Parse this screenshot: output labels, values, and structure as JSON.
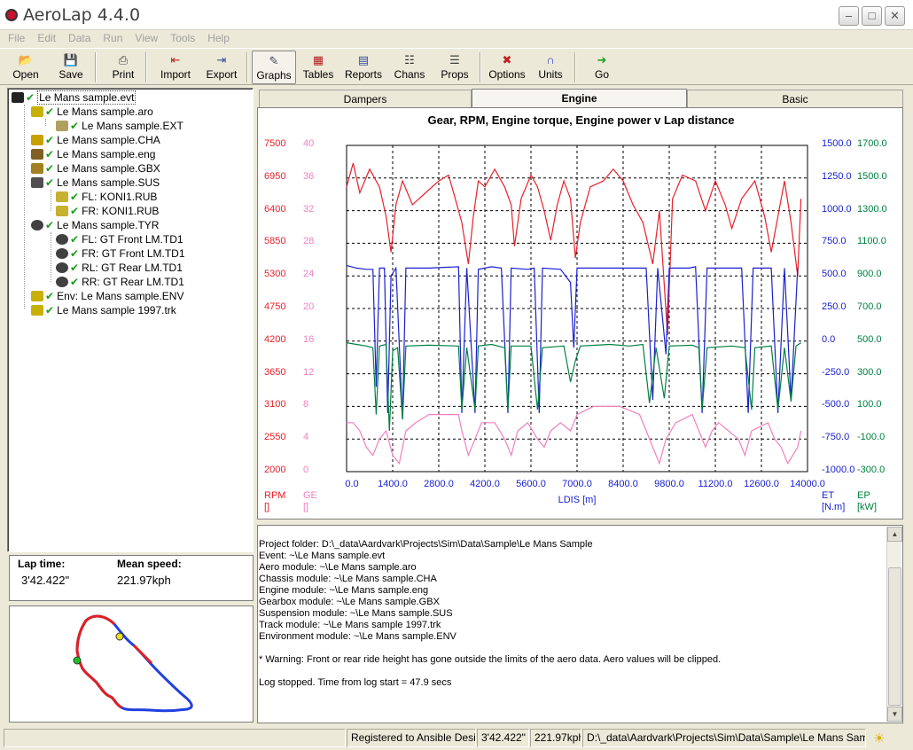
{
  "window": {
    "title": "AeroLap 4.4.0"
  },
  "menu": [
    "File",
    "Edit",
    "Data",
    "Run",
    "View",
    "Tools",
    "Help"
  ],
  "toolbar": [
    {
      "label": "Open",
      "icon": "folder-open-icon"
    },
    {
      "label": "Save",
      "icon": "floppy-disk-icon"
    },
    {
      "label": "Print",
      "icon": "printer-icon"
    },
    {
      "label": "Import",
      "icon": "import-icon"
    },
    {
      "label": "Export",
      "icon": "export-icon"
    },
    {
      "label": "Graphs",
      "icon": "graph-icon",
      "pressed": true
    },
    {
      "label": "Tables",
      "icon": "table-icon"
    },
    {
      "label": "Reports",
      "icon": "report-icon"
    },
    {
      "label": "Chans",
      "icon": "channels-icon"
    },
    {
      "label": "Props",
      "icon": "properties-icon"
    },
    {
      "label": "Options",
      "icon": "tools-icon"
    },
    {
      "label": "Units",
      "icon": "magnet-icon"
    },
    {
      "label": "Go",
      "icon": "go-arrow-icon"
    }
  ],
  "tree": [
    {
      "label": "Le Mans sample.evt",
      "level": 0,
      "icon": "chequered-flag-icon",
      "selected": true
    },
    {
      "label": "Le Mans sample.aro",
      "level": 1,
      "icon": "wing-icon"
    },
    {
      "label": "Le Mans sample.EXT",
      "level": 2,
      "icon": "extension-icon"
    },
    {
      "label": "Le Mans sample.CHA",
      "level": 1,
      "icon": "chassis-icon"
    },
    {
      "label": "Le Mans sample.eng",
      "level": 1,
      "icon": "engine-icon"
    },
    {
      "label": "Le Mans sample.GBX",
      "level": 1,
      "icon": "gearbox-icon"
    },
    {
      "label": "Le Mans sample.SUS",
      "level": 1,
      "icon": "spring-icon"
    },
    {
      "label": "FL: KONI1.RUB",
      "level": 2,
      "icon": "damper-icon"
    },
    {
      "label": "FR: KONI1.RUB",
      "level": 2,
      "icon": "damper-icon"
    },
    {
      "label": "Le Mans sample.TYR",
      "level": 1,
      "icon": "tyre-icon"
    },
    {
      "label": "FL: GT Front LM.TD1",
      "level": 2,
      "icon": "tyre-icon"
    },
    {
      "label": "FR: GT Front LM.TD1",
      "level": 2,
      "icon": "tyre-icon"
    },
    {
      "label": "RL: GT Rear LM.TD1",
      "level": 2,
      "icon": "tyre-icon"
    },
    {
      "label": "RR: GT Rear LM.TD1",
      "level": 2,
      "icon": "tyre-icon"
    },
    {
      "label": "Env: Le Mans sample.ENV",
      "level": 1,
      "icon": "weather-icon"
    },
    {
      "label": "Le Mans sample 1997.trk",
      "level": 1,
      "icon": "track-icon"
    }
  ],
  "lap": {
    "lap_time_label": "Lap time:",
    "lap_time": "3'42.422\"",
    "mean_speed_label": "Mean speed:",
    "mean_speed": "221.97kph"
  },
  "tabs": [
    {
      "label": "Dampers",
      "active": false
    },
    {
      "label": "Engine",
      "active": true
    },
    {
      "label": "Basic",
      "active": false
    }
  ],
  "chart_data": {
    "type": "line",
    "title": "Gear, RPM, Engine torque, Engine power v Lap distance",
    "xlabel": "LDIS [m]",
    "xlim": [
      0,
      14000
    ],
    "x_ticks": [
      "0.0",
      "1400.0",
      "2800.0",
      "4200.0",
      "5600.0",
      "7000.0",
      "8400.0",
      "9800.0",
      "11200.0",
      "12600.0",
      "14000.0"
    ],
    "grid": true,
    "axes": [
      {
        "name": "RPM",
        "unit": "[]",
        "side": "left",
        "color": "#e8202a",
        "ylim": [
          2000,
          7500
        ],
        "ticks": [
          "7500",
          "6950",
          "6400",
          "5850",
          "5300",
          "4750",
          "4200",
          "3650",
          "3100",
          "2550",
          "2000"
        ]
      },
      {
        "name": "GE",
        "unit": "[]",
        "side": "left",
        "color": "#f080c0",
        "ylim": [
          0,
          40
        ],
        "ticks": [
          "40",
          "36",
          "32",
          "28",
          "24",
          "20",
          "16",
          "12",
          "8",
          "4",
          "0"
        ]
      },
      {
        "name": "ET",
        "unit": "[N.m]",
        "side": "right",
        "color": "#1a20d0",
        "ylim": [
          -1000,
          1500
        ],
        "ticks": [
          "1500.0",
          "1250.0",
          "1000.0",
          "750.0",
          "500.0",
          "250.0",
          "0.0",
          "-250.0",
          "-500.0",
          "-750.0",
          "-1000.0"
        ]
      },
      {
        "name": "EP",
        "unit": "[kW]",
        "side": "right",
        "color": "#008040",
        "ylim": [
          -300,
          1700
        ],
        "ticks": [
          "1700.0",
          "1500.0",
          "1300.0",
          "1100.0",
          "900.0",
          "700.0",
          "500.0",
          "300.0",
          "100.0",
          "-100.0",
          "-300.0"
        ]
      }
    ],
    "series": [
      {
        "name": "RPM",
        "axis": "RPM",
        "color": "#e8202a",
        "points": [
          [
            0,
            6800
          ],
          [
            200,
            7200
          ],
          [
            400,
            6700
          ],
          [
            700,
            7100
          ],
          [
            1000,
            6800
          ],
          [
            1200,
            6300
          ],
          [
            1350,
            5700
          ],
          [
            1500,
            6500
          ],
          [
            1700,
            6900
          ],
          [
            2000,
            6500
          ],
          [
            2400,
            6700
          ],
          [
            2800,
            6900
          ],
          [
            3100,
            7000
          ],
          [
            3300,
            6600
          ],
          [
            3500,
            6200
          ],
          [
            3700,
            5500
          ],
          [
            3850,
            6300
          ],
          [
            4000,
            6900
          ],
          [
            4200,
            6800
          ],
          [
            4500,
            7100
          ],
          [
            4800,
            6800
          ],
          [
            5000,
            6500
          ],
          [
            5100,
            5800
          ],
          [
            5300,
            6600
          ],
          [
            5600,
            7000
          ],
          [
            5800,
            6800
          ],
          [
            6000,
            6400
          ],
          [
            6200,
            5900
          ],
          [
            6400,
            6500
          ],
          [
            6600,
            6900
          ],
          [
            6800,
            6600
          ],
          [
            6950,
            5600
          ],
          [
            7100,
            6200
          ],
          [
            7400,
            6800
          ],
          [
            7800,
            6900
          ],
          [
            8100,
            7100
          ],
          [
            8400,
            6900
          ],
          [
            8700,
            6500
          ],
          [
            9000,
            6200
          ],
          [
            9300,
            5500
          ],
          [
            9500,
            6400
          ],
          [
            9750,
            4300
          ],
          [
            9900,
            6600
          ],
          [
            10200,
            7000
          ],
          [
            10600,
            6900
          ],
          [
            10900,
            6400
          ],
          [
            11200,
            6900
          ],
          [
            11500,
            6500
          ],
          [
            11700,
            6100
          ],
          [
            12000,
            6600
          ],
          [
            12400,
            6900
          ],
          [
            12700,
            6300
          ],
          [
            12900,
            5700
          ],
          [
            13100,
            6300
          ],
          [
            13300,
            6900
          ],
          [
            13500,
            6200
          ],
          [
            13700,
            5300
          ],
          [
            13800,
            6600
          ]
        ]
      },
      {
        "name": "ET",
        "axis": "ET",
        "color": "#1a20d0",
        "points": [
          [
            0,
            580
          ],
          [
            300,
            560
          ],
          [
            600,
            550
          ],
          [
            800,
            550
          ],
          [
            900,
            -350
          ],
          [
            1000,
            560
          ],
          [
            1150,
            560
          ],
          [
            1250,
            -550
          ],
          [
            1350,
            500
          ],
          [
            1500,
            560
          ],
          [
            1700,
            -600
          ],
          [
            1800,
            560
          ],
          [
            2500,
            560
          ],
          [
            3400,
            570
          ],
          [
            3500,
            -550
          ],
          [
            3650,
            560
          ],
          [
            3900,
            -550
          ],
          [
            4000,
            550
          ],
          [
            4200,
            560
          ],
          [
            4400,
            570
          ],
          [
            4700,
            560
          ],
          [
            4900,
            -550
          ],
          [
            5000,
            560
          ],
          [
            5500,
            550
          ],
          [
            5700,
            560
          ],
          [
            5850,
            -550
          ],
          [
            5950,
            560
          ],
          [
            6500,
            550
          ],
          [
            6800,
            450
          ],
          [
            6900,
            -50
          ],
          [
            7000,
            560
          ],
          [
            7600,
            560
          ],
          [
            8500,
            560
          ],
          [
            9100,
            560
          ],
          [
            9300,
            -450
          ],
          [
            9450,
            560
          ],
          [
            9700,
            -100
          ],
          [
            9800,
            560
          ],
          [
            10400,
            560
          ],
          [
            10600,
            570
          ],
          [
            10800,
            -550
          ],
          [
            10950,
            560
          ],
          [
            11600,
            560
          ],
          [
            12000,
            560
          ],
          [
            12200,
            -550
          ],
          [
            12350,
            560
          ],
          [
            12900,
            560
          ],
          [
            13100,
            -550
          ],
          [
            13300,
            560
          ],
          [
            13500,
            -450
          ],
          [
            13700,
            560
          ]
        ]
      },
      {
        "name": "EP",
        "axis": "EP",
        "color": "#008040",
        "points": [
          [
            0,
            490
          ],
          [
            300,
            480
          ],
          [
            600,
            470
          ],
          [
            800,
            460
          ],
          [
            900,
            50
          ],
          [
            1000,
            470
          ],
          [
            1200,
            480
          ],
          [
            1300,
            -50
          ],
          [
            1400,
            440
          ],
          [
            1550,
            460
          ],
          [
            1700,
            20
          ],
          [
            1800,
            470
          ],
          [
            2500,
            475
          ],
          [
            3400,
            470
          ],
          [
            3500,
            80
          ],
          [
            3650,
            460
          ],
          [
            3900,
            80
          ],
          [
            4000,
            470
          ],
          [
            4400,
            480
          ],
          [
            4800,
            460
          ],
          [
            4900,
            80
          ],
          [
            5000,
            470
          ],
          [
            5600,
            470
          ],
          [
            5800,
            80
          ],
          [
            5950,
            460
          ],
          [
            6600,
            470
          ],
          [
            6800,
            250
          ],
          [
            6950,
            380
          ],
          [
            7100,
            470
          ],
          [
            8000,
            480
          ],
          [
            8600,
            470
          ],
          [
            9000,
            480
          ],
          [
            9200,
            120
          ],
          [
            9400,
            460
          ],
          [
            9650,
            150
          ],
          [
            9800,
            470
          ],
          [
            10500,
            475
          ],
          [
            10700,
            460
          ],
          [
            10800,
            80
          ],
          [
            10950,
            460
          ],
          [
            11700,
            470
          ],
          [
            12100,
            460
          ],
          [
            12300,
            80
          ],
          [
            12400,
            460
          ],
          [
            12900,
            470
          ],
          [
            13100,
            80
          ],
          [
            13300,
            460
          ],
          [
            13500,
            130
          ],
          [
            13650,
            470
          ],
          [
            13800,
            490
          ]
        ]
      },
      {
        "name": "GE",
        "axis": "GE",
        "color": "#f080c0",
        "points": [
          [
            0,
            6
          ],
          [
            200,
            6
          ],
          [
            400,
            5
          ],
          [
            600,
            3
          ],
          [
            800,
            2
          ],
          [
            1000,
            4
          ],
          [
            1200,
            5
          ],
          [
            1400,
            2
          ],
          [
            1600,
            1
          ],
          [
            1800,
            5
          ],
          [
            2100,
            6
          ],
          [
            2500,
            7
          ],
          [
            3000,
            7
          ],
          [
            3400,
            7
          ],
          [
            3500,
            5
          ],
          [
            3700,
            2
          ],
          [
            3900,
            4
          ],
          [
            4100,
            6
          ],
          [
            4500,
            6
          ],
          [
            4800,
            4
          ],
          [
            5000,
            2
          ],
          [
            5200,
            5
          ],
          [
            5500,
            6
          ],
          [
            5800,
            4
          ],
          [
            6000,
            3
          ],
          [
            6200,
            5
          ],
          [
            6500,
            6
          ],
          [
            6800,
            5
          ],
          [
            7000,
            7
          ],
          [
            7500,
            8
          ],
          [
            8300,
            8
          ],
          [
            8900,
            7
          ],
          [
            9100,
            5
          ],
          [
            9300,
            3
          ],
          [
            9500,
            1
          ],
          [
            9700,
            4
          ],
          [
            10000,
            6
          ],
          [
            10500,
            7
          ],
          [
            10700,
            5
          ],
          [
            10900,
            3
          ],
          [
            11100,
            5
          ],
          [
            11300,
            6
          ],
          [
            11600,
            5
          ],
          [
            11900,
            4
          ],
          [
            12100,
            2
          ],
          [
            12300,
            5
          ],
          [
            12800,
            6
          ],
          [
            13000,
            4
          ],
          [
            13200,
            3
          ],
          [
            13400,
            1
          ],
          [
            13700,
            3
          ],
          [
            13800,
            5
          ]
        ]
      }
    ]
  },
  "log": {
    "lines": [
      "Project folder: D:\\_data\\Aardvark\\Projects\\Sim\\Data\\Sample\\Le Mans Sample",
      "Event: ~\\Le Mans sample.evt",
      "Aero module: ~\\Le Mans sample.aro",
      "Chassis module: ~\\Le Mans sample.CHA",
      "Engine module: ~\\Le Mans sample.eng",
      "Gearbox module: ~\\Le Mans sample.GBX",
      "Suspension module: ~\\Le Mans sample.SUS",
      "Track module: ~\\Le Mans sample 1997.trk",
      "Environment module: ~\\Le Mans sample.ENV",
      "",
      "* Warning: Front or rear ride height has gone outside the limits of the aero data. Aero values will be clipped.",
      "",
      "Log stopped. Time from log start = 47.9 secs"
    ]
  },
  "status": {
    "registered": "Registered to Ansible Design",
    "lap_time": "3'42.422\"",
    "speed": "221.97kph",
    "path": "D:\\_data\\Aardvark\\Projects\\Sim\\Data\\Sample\\Le Mans Sample"
  },
  "colors": {
    "window_bg": "#ece9d8",
    "rpm": "#e8202a",
    "gear": "#f080c0",
    "torque": "#1a20d0",
    "power": "#008040",
    "track_main": "#2040e0",
    "track_alt": "#e02020"
  }
}
